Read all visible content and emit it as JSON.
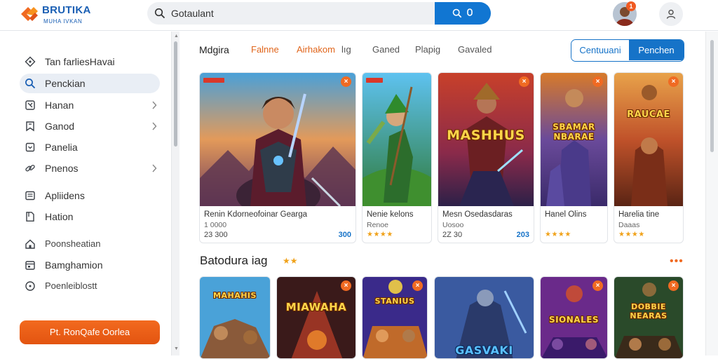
{
  "app": {
    "title": "BRUTIKA",
    "subtitle": "MUHA IVKAN",
    "colors": {
      "accent": "#1673c8",
      "brand_orange": "#f06a22",
      "star": "#f0a21a"
    }
  },
  "search": {
    "value": "Gotaulant",
    "button_icons": [
      "search-icon",
      "mic-icon"
    ]
  },
  "header": {
    "avatar_badge": "1",
    "user_icon": "user-icon"
  },
  "sidebar": {
    "items": [
      {
        "label": "Tan farliesHavai",
        "icon": "diamond-icon",
        "chevron": false,
        "active": false
      },
      {
        "label": "Penckian",
        "icon": "search-icon",
        "chevron": false,
        "active": true
      },
      {
        "label": "Hanan",
        "icon": "pad-icon",
        "chevron": true,
        "active": false
      },
      {
        "label": "Ganod",
        "icon": "bookmark-icon",
        "chevron": true,
        "active": false
      },
      {
        "label": "Panelia",
        "icon": "box-icon",
        "chevron": false,
        "active": false
      },
      {
        "label": "Pnenos",
        "icon": "link-icon",
        "chevron": true,
        "active": false
      },
      {
        "label": "Apliidens",
        "icon": "list-icon",
        "chevron": false,
        "active": false
      },
      {
        "label": "Hation",
        "icon": "doc-icon",
        "chevron": false,
        "active": false
      },
      {
        "label": "Poonsheatian",
        "icon": "home-icon",
        "chevron": false,
        "active": false
      },
      {
        "label": "Bamghamion",
        "icon": "calendar-icon",
        "chevron": false,
        "active": false
      },
      {
        "label": "Poenleiblostt",
        "icon": "info-icon",
        "chevron": false,
        "active": false
      }
    ],
    "cta": "Pt. RonQafe Oorlea"
  },
  "main": {
    "tabs": [
      "Mdgira",
      "Falnne",
      "Airhakom",
      "lıg",
      "Ganed",
      "Plapig",
      "Gavaled"
    ],
    "segment": {
      "left": "Centuuani",
      "right": "Penchen"
    },
    "row1": [
      {
        "title": "Renin Kdorneofoinar Gearga",
        "sub": "1 0000",
        "price": "23 300",
        "score": "300",
        "art_title": ""
      },
      {
        "title": "Nenie kelons",
        "sub": "Renoe",
        "stars": "★★★★",
        "art_title": ""
      },
      {
        "title": "Mesn Osedasdaras",
        "sub": "Uosoo",
        "price": "2Z 30",
        "score": "203",
        "art_title": "MASHHUS"
      },
      {
        "title": "Hanel Olins",
        "sub": "",
        "stars": "★★★★",
        "art_title": "SBAMAR NBARAE"
      },
      {
        "title": "Harelia tine",
        "sub": "Daaas",
        "stars": "★★★★",
        "art_title": "RAUCAE"
      }
    ],
    "section2": {
      "title": "Batodura iag",
      "stars": "★★"
    },
    "row2": [
      {
        "art_title": "MAHAHIS"
      },
      {
        "art_title": "MIAWAHA"
      },
      {
        "art_title": "STANIUS"
      },
      {
        "art_title": "GASVAKI"
      },
      {
        "art_title": "SIONALES"
      },
      {
        "art_title": "DOBBIE NEARAS"
      }
    ]
  }
}
